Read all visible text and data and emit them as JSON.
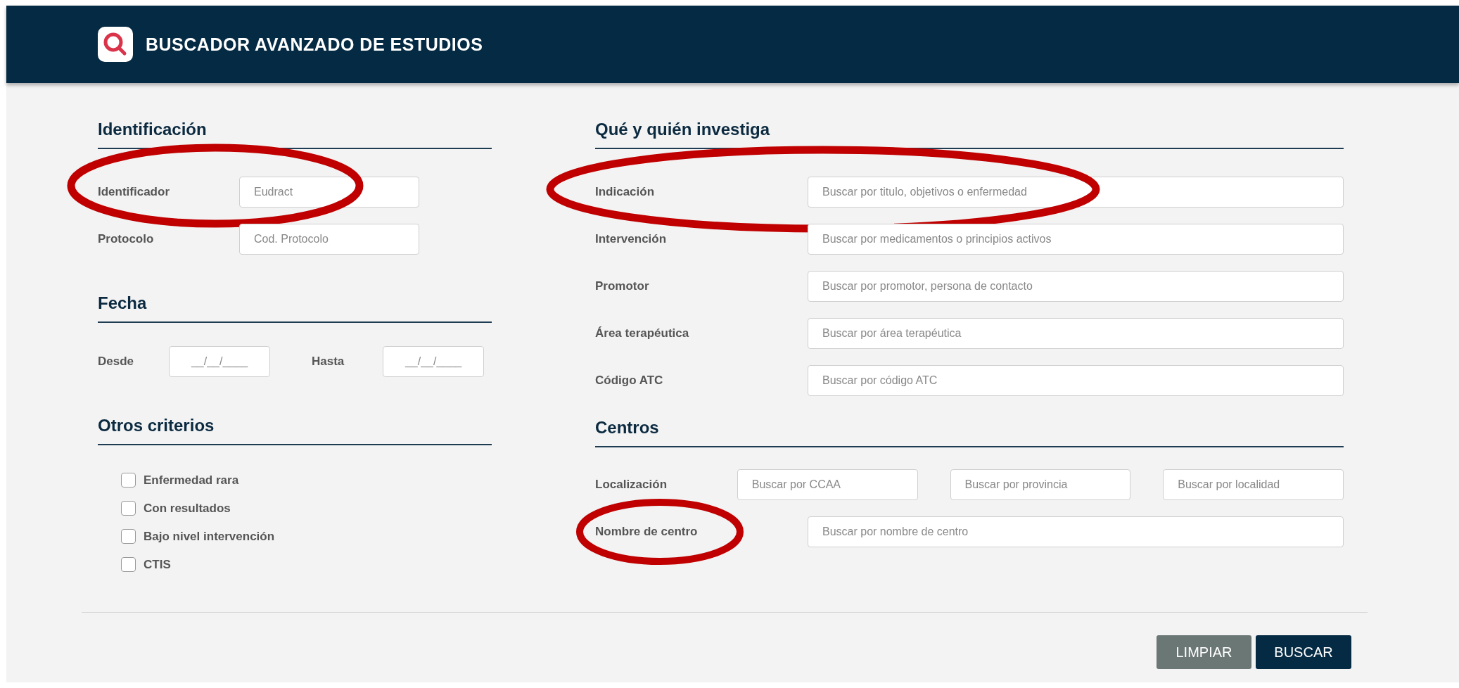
{
  "header": {
    "title": "BUSCADOR AVANZADO DE ESTUDIOS"
  },
  "identificacion": {
    "title": "Identificación",
    "fields": [
      {
        "label": "Identificador",
        "placeholder": "Eudract",
        "circled": true
      },
      {
        "label": "Protocolo",
        "placeholder": "Cod. Protocolo",
        "circled": false
      }
    ]
  },
  "fecha": {
    "title": "Fecha",
    "fields": [
      {
        "label": "Desde",
        "placeholder": "__/__/____"
      },
      {
        "label": "Hasta",
        "placeholder": "__/__/____"
      }
    ]
  },
  "otros_criterios": {
    "title": "Otros criterios",
    "options": [
      {
        "label": "Enfermedad rara",
        "checked": false
      },
      {
        "label": "Con resultados",
        "checked": false
      },
      {
        "label": "Bajo nivel intervención",
        "checked": false
      },
      {
        "label": "CTIS",
        "checked": false
      }
    ]
  },
  "que_y_quien": {
    "title": "Qué y quién investiga",
    "fields": [
      {
        "label": "Indicación",
        "placeholder": "Buscar por titulo, objetivos o enfermedad",
        "circled": true
      },
      {
        "label": "Intervención",
        "placeholder": "Buscar por medicamentos o principios activos",
        "circled": false
      },
      {
        "label": "Promotor",
        "placeholder": "Buscar por promotor, persona de contacto",
        "circled": false
      },
      {
        "label": "Área terapéutica",
        "placeholder": "Buscar por área terapéutica",
        "circled": false
      },
      {
        "label": "Código ATC",
        "placeholder": "Buscar por código ATC",
        "circled": false
      }
    ]
  },
  "centros": {
    "title": "Centros",
    "localizacion": {
      "label": "Localización",
      "placeholders": [
        "Buscar por CCAA",
        "Buscar por provincia",
        "Buscar por localidad"
      ]
    },
    "fields": [
      {
        "label": "Nombre de centro",
        "placeholder": "Buscar por nombre de centro",
        "circled": true
      }
    ]
  },
  "buttons": [
    {
      "label": "LIMPIAR",
      "kind": "secondary"
    },
    {
      "label": "BUSCAR",
      "kind": "primary"
    }
  ]
}
